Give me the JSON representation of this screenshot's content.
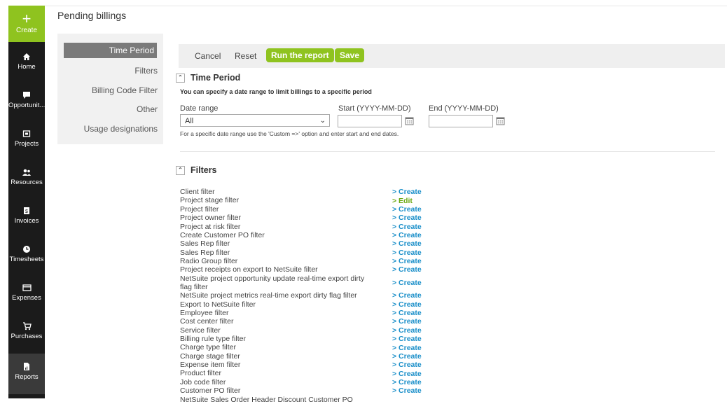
{
  "nav": {
    "create_label": "Create",
    "items": [
      {
        "label": "Home",
        "icon": "home-icon"
      },
      {
        "label": "Opportunit...",
        "icon": "chat-icon"
      },
      {
        "label": "Projects",
        "icon": "projects-icon"
      },
      {
        "label": "Resources",
        "icon": "users-icon"
      },
      {
        "label": "Invoices",
        "icon": "invoice-icon"
      },
      {
        "label": "Timesheets",
        "icon": "clock-icon"
      },
      {
        "label": "Expenses",
        "icon": "card-icon"
      },
      {
        "label": "Purchases",
        "icon": "cart-icon"
      },
      {
        "label": "Reports",
        "icon": "report-icon"
      }
    ]
  },
  "page": {
    "title": "Pending billings"
  },
  "sidemenu": {
    "items": [
      "Time Period",
      "Filters",
      "Billing Code Filter",
      "Other",
      "Usage designations"
    ]
  },
  "toolbar": {
    "cancel": "Cancel",
    "reset": "Reset",
    "run": "Run the report",
    "save": "Save"
  },
  "time_period": {
    "heading": "Time Period",
    "description": "You can specify a date range to limit billings to a specific period",
    "date_range_label": "Date range",
    "date_range_value": "All",
    "start_label": "Start (YYYY-MM-DD)",
    "end_label": "End (YYYY-MM-DD)",
    "hint": "For a specific date range use the 'Custom =>' option and enter start and end dates."
  },
  "filters": {
    "heading": "Filters",
    "rows": [
      {
        "name": "Client filter",
        "action": "> Create"
      },
      {
        "name": "Project stage filter",
        "action": "> Edit"
      },
      {
        "name": "Project filter",
        "action": "> Create"
      },
      {
        "name": "Project owner filter",
        "action": "> Create"
      },
      {
        "name": "Project at risk filter",
        "action": "> Create"
      },
      {
        "name": "Create Customer PO filter",
        "action": "> Create"
      },
      {
        "name": "Sales Rep filter",
        "action": "> Create"
      },
      {
        "name": "Sales Rep filter",
        "action": "> Create"
      },
      {
        "name": "Radio Group filter",
        "action": "> Create"
      },
      {
        "name": "Project receipts on export to NetSuite filter",
        "action": "> Create"
      },
      {
        "name": "NetSuite project opportunity update real-time export dirty flag filter",
        "action": "> Create"
      },
      {
        "name": "NetSuite project metrics real-time export dirty flag filter",
        "action": "> Create"
      },
      {
        "name": "Export to NetSuite filter",
        "action": "> Create"
      },
      {
        "name": "Employee filter",
        "action": "> Create"
      },
      {
        "name": "Cost center filter",
        "action": "> Create"
      },
      {
        "name": "Service filter",
        "action": "> Create"
      },
      {
        "name": "Billing rule type filter",
        "action": "> Create"
      },
      {
        "name": "Charge type filter",
        "action": "> Create"
      },
      {
        "name": "Charge stage filter",
        "action": "> Create"
      },
      {
        "name": "Expense item filter",
        "action": "> Create"
      },
      {
        "name": "Product filter",
        "action": "> Create"
      },
      {
        "name": "Job code filter",
        "action": "> Create"
      },
      {
        "name": "Customer PO filter",
        "action": "> Create"
      },
      {
        "name": "NetSuite Sales Order Header Discount Customer PO",
        "action": ""
      }
    ]
  },
  "colors": {
    "accent": "#8fc31f",
    "link": "#1a8fc9",
    "edit": "#6aa810",
    "nav_bg": "#1b1b1b"
  }
}
